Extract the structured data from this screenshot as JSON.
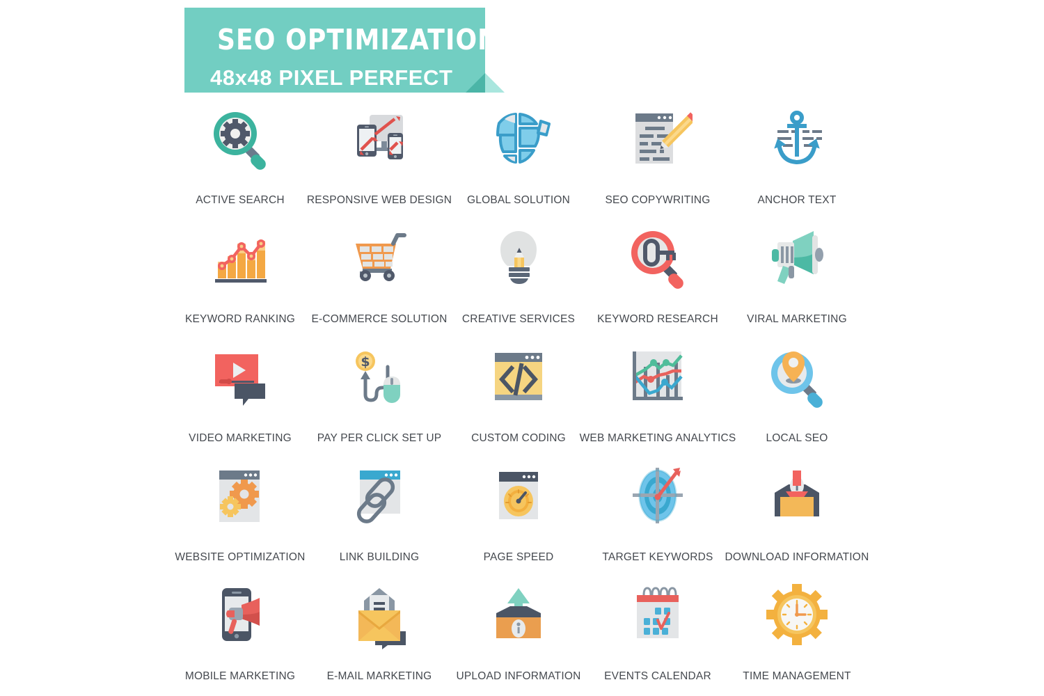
{
  "banner": {
    "title": "SEO OPTIMIZATION",
    "subtitle": "48x48 PIXEL PERFECT",
    "bg_color": "#72cec2",
    "fold_dark_color": "#4bb5a7",
    "fold_light_color": "#a9e6de",
    "text_color": "#ffffff"
  },
  "palette": {
    "teal": "#3cb39e",
    "mint": "#7fd1c0",
    "slate": "#50596a",
    "slate_light": "#7c8a99",
    "gray": "#dcdcdc",
    "gray_light": "#e8e8e8",
    "red": "#f2635f",
    "red_dark": "#e0524d",
    "orange": "#f0994d",
    "yellow": "#f6c55e",
    "yellow_light": "#fbd98b",
    "blue": "#4ab0d7",
    "blue_light": "#7fcdea",
    "green": "#4fbd9a",
    "label_color": "#45494f"
  },
  "grid": {
    "columns": 5,
    "rows": 5,
    "icon_size": "48x48",
    "items": [
      {
        "label": "ACTIVE SEARCH",
        "icon": "magnifier-gear-icon"
      },
      {
        "label": "RESPONSIVE WEB DESIGN",
        "icon": "responsive-devices-icon"
      },
      {
        "label": "GLOBAL SOLUTION",
        "icon": "broken-globe-icon"
      },
      {
        "label": "SEO COPYWRITING",
        "icon": "document-pencil-icon"
      },
      {
        "label": "ANCHOR TEXT",
        "icon": "anchor-icon"
      },
      {
        "label": "KEYWORD RANKING",
        "icon": "bar-line-chart-icon"
      },
      {
        "label": "E-COMMERCE SOLUTION",
        "icon": "shopping-cart-icon"
      },
      {
        "label": "CREATIVE SERVICES",
        "icon": "lightbulb-pencil-icon"
      },
      {
        "label": "KEYWORD RESEARCH",
        "icon": "magnifier-key-icon"
      },
      {
        "label": "VIRAL MARKETING",
        "icon": "megaphone-icon"
      },
      {
        "label": "VIDEO MARKETING",
        "icon": "video-player-chat-icon"
      },
      {
        "label": "PAY PER CLICK SET UP",
        "icon": "coin-mouse-icon"
      },
      {
        "label": "CUSTOM CODING",
        "icon": "code-window-icon"
      },
      {
        "label": "WEB MARKETING ANALYTICS",
        "icon": "multi-line-chart-icon"
      },
      {
        "label": "LOCAL SEO",
        "icon": "magnifier-pin-icon"
      },
      {
        "label": "WEBSITE OPTIMIZATION",
        "icon": "window-gears-icon"
      },
      {
        "label": "LINK BUILDING",
        "icon": "window-chain-link-icon"
      },
      {
        "label": "PAGE SPEED",
        "icon": "window-gauge-icon"
      },
      {
        "label": "TARGET KEYWORDS",
        "icon": "target-arrow-icon"
      },
      {
        "label": "DOWNLOAD INFORMATION",
        "icon": "download-box-icon"
      },
      {
        "label": "MOBILE MARKETING",
        "icon": "phone-megaphone-icon"
      },
      {
        "label": "E-MAIL MARKETING",
        "icon": "envelope-chat-icon"
      },
      {
        "label": "UPLOAD INFORMATION",
        "icon": "upload-box-icon"
      },
      {
        "label": "EVENTS CALENDAR",
        "icon": "calendar-check-icon"
      },
      {
        "label": "TIME MANAGEMENT",
        "icon": "clock-gear-icon"
      }
    ]
  }
}
